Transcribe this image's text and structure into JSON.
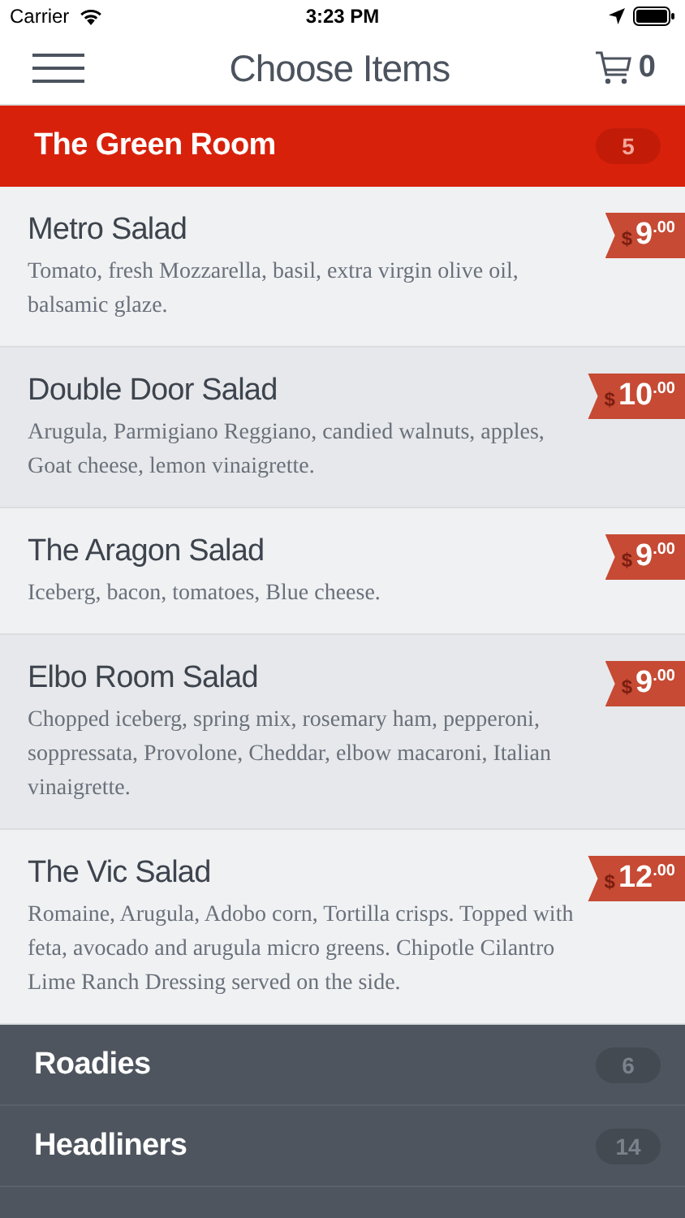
{
  "status_bar": {
    "carrier": "Carrier",
    "time": "3:23 PM"
  },
  "nav": {
    "title": "Choose Items",
    "cart_count": "0"
  },
  "sections": [
    {
      "name": "The Green Room",
      "count": "5",
      "expanded": true,
      "items": [
        {
          "name": "Metro Salad",
          "description": "Tomato, fresh Mozzarella, basil, extra virgin olive oil, balsamic glaze.",
          "currency": "$",
          "amount": "9",
          "cents": ".00"
        },
        {
          "name": "Double Door Salad",
          "description": "Arugula, Parmigiano Reggiano, candied walnuts, apples, Goat cheese, lemon vinaigrette.",
          "currency": "$",
          "amount": "10",
          "cents": ".00"
        },
        {
          "name": "The Aragon Salad",
          "description": "Iceberg, bacon, tomatoes, Blue cheese.",
          "currency": "$",
          "amount": "9",
          "cents": ".00"
        },
        {
          "name": "Elbo Room Salad",
          "description": "Chopped iceberg, spring mix, rosemary ham, pepperoni, soppressata, Provolone, Cheddar, elbow macaroni, Italian vinaigrette.",
          "currency": "$",
          "amount": "9",
          "cents": ".00"
        },
        {
          "name": "The Vic Salad",
          "description": "Romaine, Arugula, Adobo corn, Tortilla crisps. Topped with feta, avocado and arugula micro greens. Chipotle Cilantro Lime Ranch Dressing served on the side.",
          "currency": "$",
          "amount": "12",
          "cents": ".00"
        }
      ]
    },
    {
      "name": "Roadies",
      "count": "6",
      "expanded": false
    },
    {
      "name": "Headliners",
      "count": "14",
      "expanded": false
    }
  ]
}
